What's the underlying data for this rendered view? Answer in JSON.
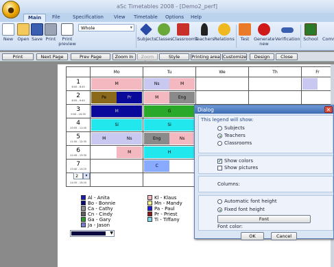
{
  "app": {
    "title": "aSc Timetables 2008 - [Demo2_perf]"
  },
  "ribbon_tabs": [
    "Main",
    "File",
    "Specification",
    "View",
    "Timetable",
    "Options",
    "Help"
  ],
  "ribbon_buttons": {
    "new": "New",
    "open": "Open",
    "save": "Save",
    "print": "Print",
    "print_preview": "Print preview",
    "view_select": "Whole",
    "subjects": "Subjects",
    "classes": "Classes",
    "classrooms": "Classrooms",
    "teachers": "Teachers",
    "relations": "Relations",
    "test": "Test",
    "generate_new": "Generate new",
    "verification": "Verification",
    "school": "School",
    "cut_label": "Comm"
  },
  "toolbar": [
    "Print",
    "Next Page",
    "Prev Page",
    "Zoom In",
    "Zoom Out",
    "Style",
    "Printing area",
    "Customize",
    "Design",
    "Close"
  ],
  "timetable": {
    "days": [
      "Mo",
      "Tu",
      "We",
      "Th",
      "Fr"
    ],
    "periods": [
      {
        "n": "1",
        "t": "8:00 - 8:45"
      },
      {
        "n": "2",
        "t": "8:55 - 9:40"
      },
      {
        "n": "3",
        "t": "9:50 - 10:35"
      },
      {
        "n": "4",
        "t": "10:55 - 11:40"
      },
      {
        "n": "5",
        "t": "11:50 - 12:35"
      },
      {
        "n": "6",
        "t": "12:45 - 13:30"
      },
      {
        "n": "7",
        "t": "13:40 - 14:25"
      },
      {
        "n": "8",
        "t": "14:35 - 15:20"
      }
    ],
    "lessons": {
      "mo1": "M",
      "tu1a": "Ns",
      "tu1b": "M",
      "mo2a": "Pe",
      "mo2b": "Pr",
      "tu2a": "M",
      "tu2b": "Eng",
      "mo3": "M",
      "tu3": "G",
      "mo4": "Si",
      "tu4": "Si",
      "mo5a": "M",
      "mo5b": "Ns",
      "tu5a": "Eng",
      "tu5b": "Ns",
      "mo6": "M",
      "tu6": "H",
      "tu7": "C"
    }
  },
  "legend": [
    {
      "label": "Al - Anita",
      "color": "#1a1ab0"
    },
    {
      "label": "Bo - Bonnie",
      "color": "#0a0a78"
    },
    {
      "label": "Ca - Cathy",
      "color": "#909090"
    },
    {
      "label": "Cn - Cindy",
      "color": "#606060"
    },
    {
      "label": "Ga - Gary",
      "color": "#2a9a2a"
    },
    {
      "label": "Ja - Jason",
      "color": "#7a7ad0"
    },
    {
      "label": "Kl - Klaus",
      "color": "#f4b8c0"
    },
    {
      "label": "Mn - Mandy",
      "color": "#ffff9a"
    },
    {
      "label": "Pa - Paul",
      "color": "#1a1ad8"
    },
    {
      "label": "Pr - Priest",
      "color": "#8a1a1a"
    },
    {
      "label": "Ti - Tiffany",
      "color": "#7ad8e8"
    }
  ],
  "dialog": {
    "title": "Dialog",
    "legend_heading": "This legend will show:",
    "opt_subjects": "Subjects",
    "opt_teachers": "Teachers",
    "opt_classrooms": "Classrooms",
    "show_colors": "Show colors",
    "show_pictures": "Show pictures",
    "columns_label": "Columns:",
    "columns_value": "2",
    "auto_font": "Automatic font height",
    "fixed_font": "Fixed font height",
    "font_button": "Font",
    "font_color_label": "Font color:",
    "font_color": "#0a0a40",
    "ok": "OK",
    "cancel": "Cancel"
  },
  "colors": {
    "mo_period_1": "#f4b8c0",
    "ns": "#f4b8c0",
    "purple_m": "#c8c8f0",
    "pe": "#8a6a1a",
    "pr": "#0a0a9a",
    "eng": "#8a8a8a",
    "green": "#2aa82a",
    "cyan": "#22e8ee",
    "blue_c": "#88aaff"
  }
}
